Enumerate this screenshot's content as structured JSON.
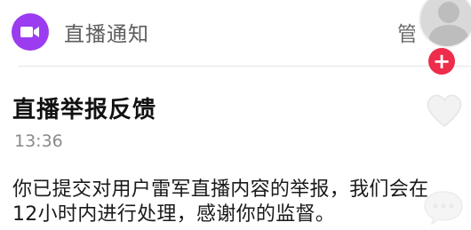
{
  "header": {
    "app_icon": "video-camera-icon",
    "app_name": "直播通知",
    "manage_label": "管"
  },
  "notification": {
    "title": "直播举报反馈",
    "time": "13:36",
    "message": "你已提交对用户雷军直播内容的举报，我们会在12小时内进行处理，感谢你的监督。"
  },
  "overlay": {
    "avatar_icon": "user-avatar-icon",
    "follow_icon": "plus-icon",
    "follow_label": "+",
    "like_icon": "heart-icon",
    "comment_icon": "comment-icon"
  },
  "colors": {
    "accent_purple": "#9b3cf0",
    "follow_red": "#ee2c4c"
  }
}
